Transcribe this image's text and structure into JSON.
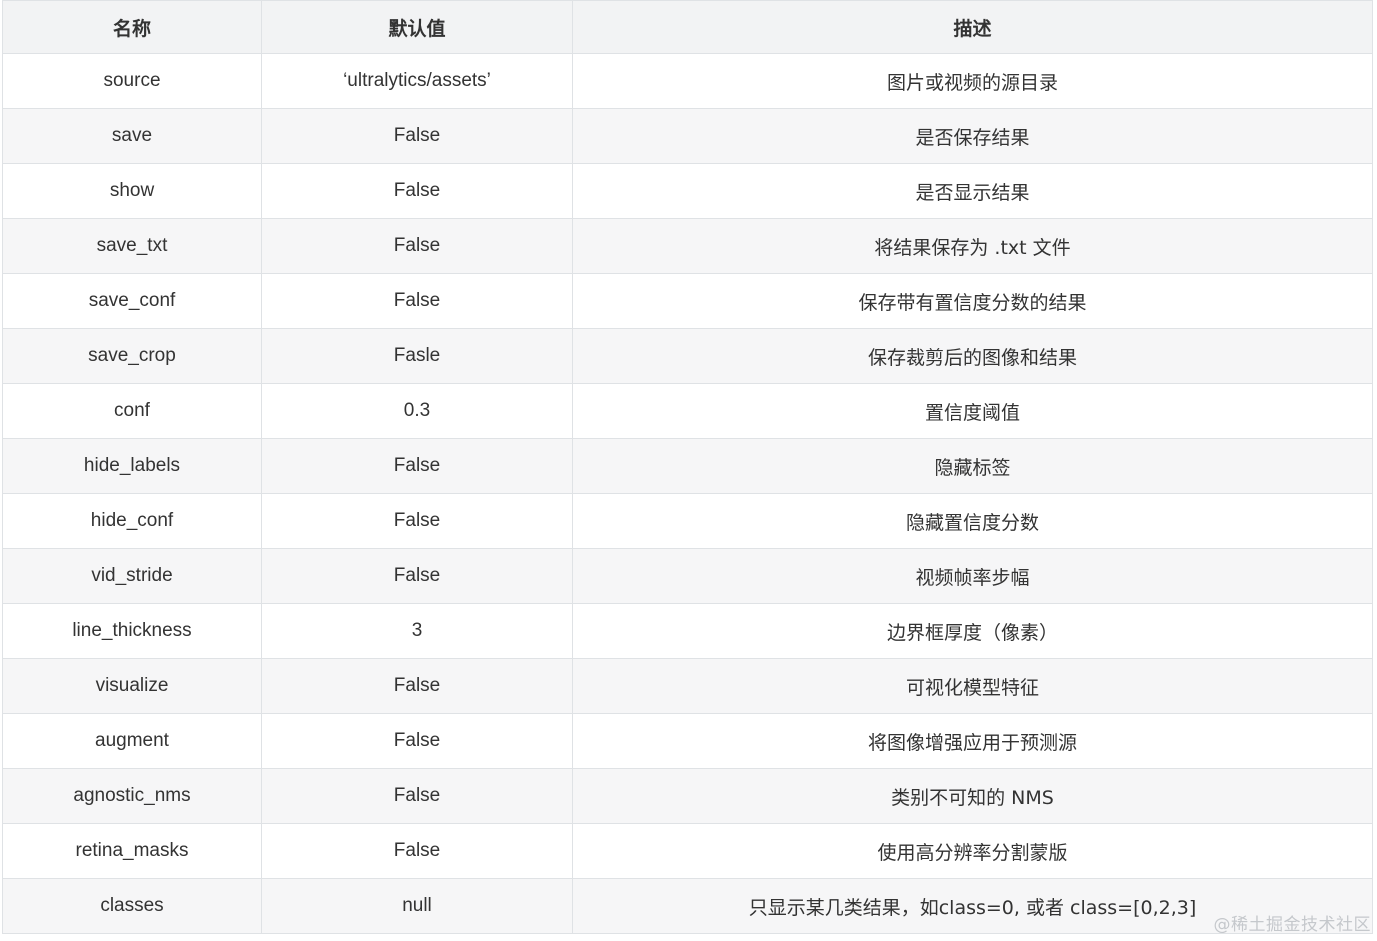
{
  "table": {
    "headers": [
      "名称",
      "默认值",
      "描述"
    ],
    "rows": [
      {
        "name": "source",
        "default": "‘ultralytics/assets’",
        "desc": "图片或视频的源目录"
      },
      {
        "name": "save",
        "default": "False",
        "desc": "是否保存结果"
      },
      {
        "name": "show",
        "default": "False",
        "desc": "是否显示结果"
      },
      {
        "name": "save_txt",
        "default": "False",
        "desc": "将结果保存为 .txt 文件"
      },
      {
        "name": "save_conf",
        "default": "False",
        "desc": "保存带有置信度分数的结果"
      },
      {
        "name": "save_crop",
        "default": "Fasle",
        "desc": "保存裁剪后的图像和结果"
      },
      {
        "name": "conf",
        "default": "0.3",
        "desc": "置信度阈值"
      },
      {
        "name": "hide_labels",
        "default": "False",
        "desc": "隐藏标签"
      },
      {
        "name": "hide_conf",
        "default": "False",
        "desc": "隐藏置信度分数"
      },
      {
        "name": "vid_stride",
        "default": "False",
        "desc": "视频帧率步幅"
      },
      {
        "name": "line_thickness",
        "default": "3",
        "desc": "边界框厚度（像素）"
      },
      {
        "name": "visualize",
        "default": "False",
        "desc": "可视化模型特征"
      },
      {
        "name": "augment",
        "default": "False",
        "desc": "将图像增强应用于预测源"
      },
      {
        "name": "agnostic_nms",
        "default": "False",
        "desc": "类别不可知的 NMS"
      },
      {
        "name": "retina_masks",
        "default": "False",
        "desc": "使用高分辨率分割蒙版"
      },
      {
        "name": "classes",
        "default": "null",
        "desc": "只显示某几类结果，如class=0, 或者 class=[0,2,3]"
      }
    ]
  },
  "watermark": "@稀土掘金技术社区"
}
